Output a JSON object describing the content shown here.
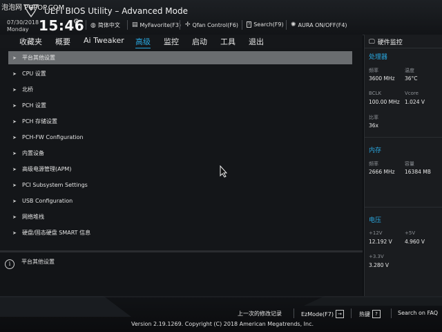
{
  "watermark": "泡泡网 PCPOP.COM",
  "header": {
    "title": "UEFI BIOS Utility – Advanced Mode",
    "date": "07/30/2018",
    "weekday": "Monday",
    "time": "15:46",
    "buttons": [
      {
        "label": "简体中文",
        "icon": "globe-icon"
      },
      {
        "label": "MyFavorite(F3)",
        "icon": "favorite-icon"
      },
      {
        "label": "Qfan Control(F6)",
        "icon": "fan-icon"
      },
      {
        "label": "Search(F9)",
        "icon": "search-icon"
      },
      {
        "label": "AURA ON/OFF(F4)",
        "icon": "aura-icon"
      }
    ]
  },
  "tabs": [
    "收藏夹",
    "概要",
    "Ai Tweaker",
    "高级",
    "监控",
    "启动",
    "工具",
    "退出"
  ],
  "active_tab": "高级",
  "menu": [
    "平台其他设置",
    "CPU 设置",
    "北桥",
    "PCH 设置",
    "PCH 存储设置",
    "PCH-FW Configuration",
    "内置设备",
    "高级电源管理(APM)",
    "PCI Subsystem Settings",
    "USB Configuration",
    "网络堆栈",
    "硬盘/固态硬盘 SMART 信息"
  ],
  "selected_menu": "平台其他设置",
  "help": {
    "text": "平台其他设置"
  },
  "hardware_monitor": {
    "title": "硬件监控",
    "cpu": {
      "section": "处理器",
      "freq_label": "频率",
      "freq_value": "3600 MHz",
      "temp_label": "温度",
      "temp_value": "36°C",
      "bclk_label": "BCLK",
      "bclk_value": "100.00 MHz",
      "vcore_label": "Vcore",
      "vcore_value": "1.024 V",
      "ratio_label": "比率",
      "ratio_value": "36x"
    },
    "memory": {
      "section": "内存",
      "freq_label": "频率",
      "freq_value": "2666 MHz",
      "cap_label": "容量",
      "cap_value": "16384 MB"
    },
    "voltage": {
      "section": "电压",
      "v12_label": "+12V",
      "v12_value": "12.192 V",
      "v5_label": "+5V",
      "v5_value": "4.960 V",
      "v33_label": "+3.3V",
      "v33_value": "3.280 V"
    }
  },
  "footer": {
    "last_modified": "上一次的修改记录",
    "ezmode": "EzMode(F7)",
    "hotkeys": "热键",
    "hotkeys_key": "?",
    "search_faq": "Search on FAQ",
    "version": "Version 2.19.1269. Copyright (C) 2018 American Megatrends, Inc."
  },
  "colors": {
    "accent": "#29a8e0",
    "selected_row": "#6a6d70",
    "background": "#141619"
  }
}
